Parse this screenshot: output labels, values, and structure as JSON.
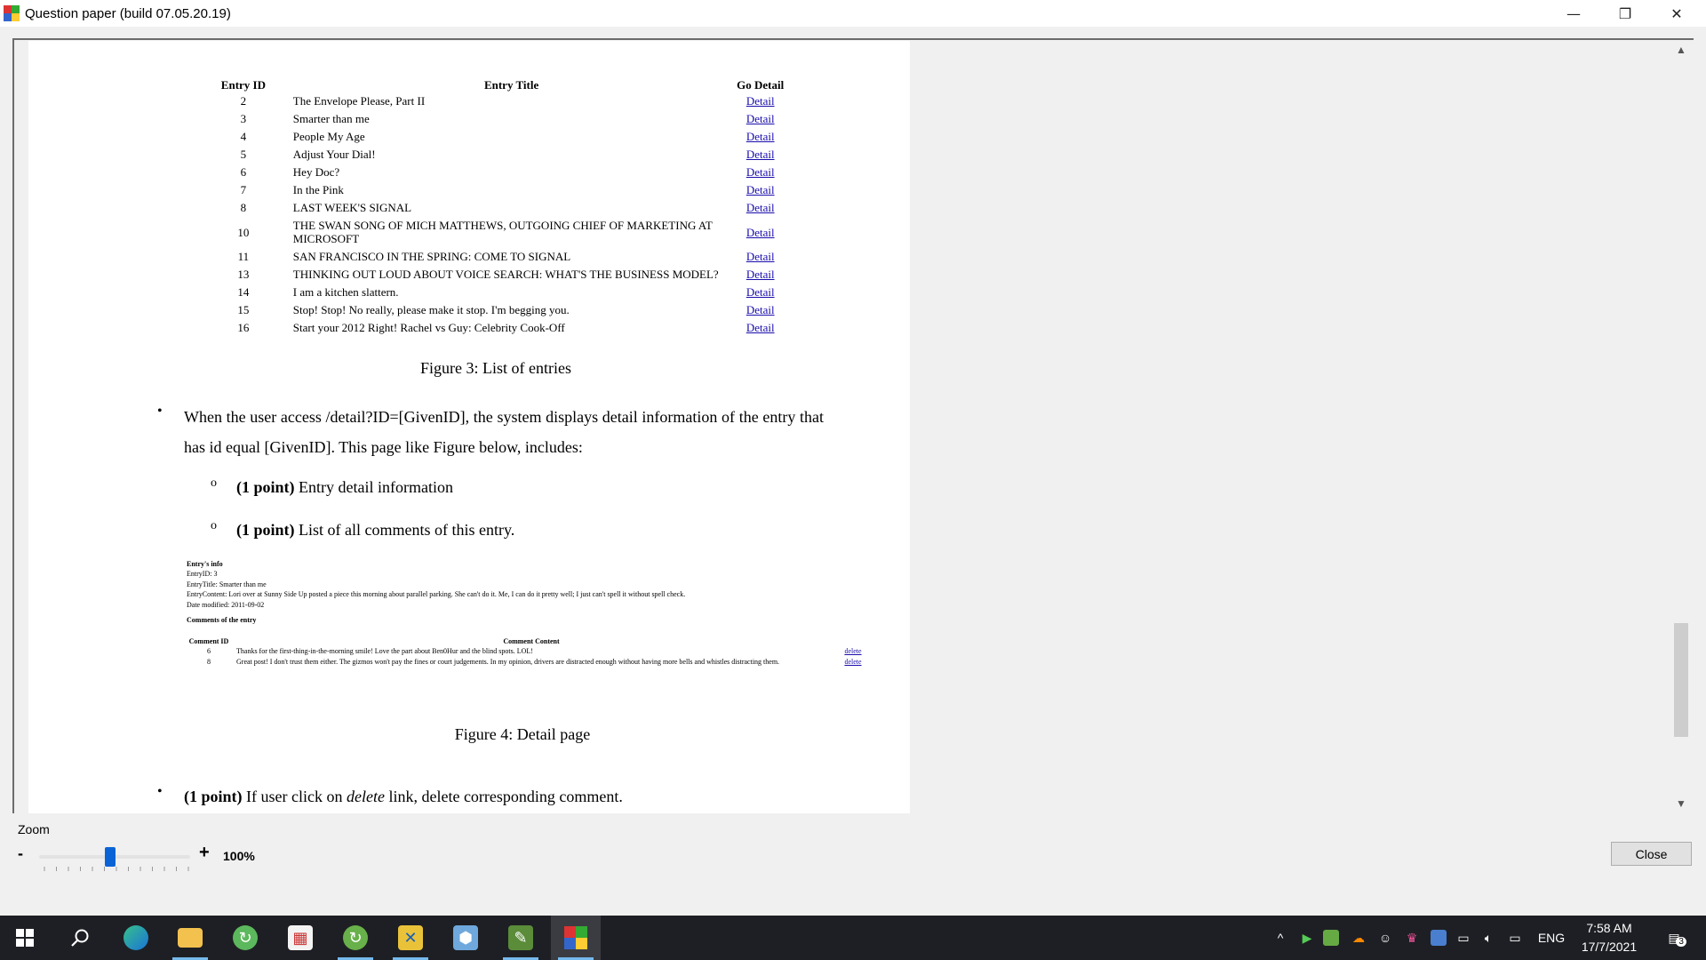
{
  "window": {
    "title": "Question paper (build 07.05.20.19)",
    "minimize": "—",
    "restore": "❐",
    "close": "✕"
  },
  "figure3": {
    "headers": {
      "id": "Entry ID",
      "title": "Entry Title",
      "go": "Go Detail"
    },
    "rows": [
      {
        "id": "2",
        "title": "The Envelope Please, Part II",
        "link": "Detail"
      },
      {
        "id": "3",
        "title": "Smarter than me",
        "link": "Detail"
      },
      {
        "id": "4",
        "title": "People My Age",
        "link": "Detail"
      },
      {
        "id": "5",
        "title": "Adjust Your Dial!",
        "link": "Detail"
      },
      {
        "id": "6",
        "title": "Hey Doc?",
        "link": "Detail"
      },
      {
        "id": "7",
        "title": "In the Pink",
        "link": "Detail"
      },
      {
        "id": "8",
        "title": "LAST WEEK'S SIGNAL",
        "link": "Detail"
      },
      {
        "id": "10",
        "title": "THE SWAN SONG OF MICH MATTHEWS, OUTGOING CHIEF OF MARKETING AT MICROSOFT",
        "link": "Detail"
      },
      {
        "id": "11",
        "title": "SAN FRANCISCO IN THE SPRING: COME TO SIGNAL",
        "link": "Detail"
      },
      {
        "id": "13",
        "title": "THINKING OUT LOUD ABOUT VOICE SEARCH: WHAT'S THE BUSINESS MODEL?",
        "link": "Detail"
      },
      {
        "id": "14",
        "title": "I am a kitchen slattern.",
        "link": "Detail"
      },
      {
        "id": "15",
        "title": "Stop! Stop! No really, please make it stop. I'm begging you.",
        "link": "Detail"
      },
      {
        "id": "16",
        "title": "Start your 2012 Right! Rachel vs Guy: Celebrity Cook-Off",
        "link": "Detail"
      }
    ],
    "caption": "Figure 3: List of entries"
  },
  "body": {
    "bullet_symbol": "•",
    "circle_symbol": "o",
    "p1": "When the user access /detail?ID=[GivenID], the system displays detail information of the entry that has id equal [GivenID]. This page like Figure below, includes:",
    "p2_bold": "(1 point)",
    "p2_text": " Entry detail information",
    "p3_bold": "(1 point)",
    "p3_text": " List of all comments of this entry.",
    "p4_bold": "(1 point)",
    "p4_text_a": " If user click on ",
    "p4_italic": "delete",
    "p4_text_b": " link, delete corresponding comment."
  },
  "figure4": {
    "info_heading": "Entry's info",
    "entry_id": "EntryID: 3",
    "entry_title": "EntryTitle: Smarter than me",
    "entry_content": "EntryContent: Lori over at Sunny Side Up posted a piece this morning about parallel parking. She can't do it. Me, I can do it pretty well; I just can't spell it without spell check.",
    "date_modified": "Date modified: 2011-09-02",
    "comments_heading": "Comments of the entry",
    "headers": {
      "id": "Comment ID",
      "content": "Comment Content"
    },
    "comments": [
      {
        "id": "6",
        "content": "Thanks for the first-thing-in-the-morning smile! Love the part about Ben0Hur and the blind spots. LOL!",
        "link": "delete"
      },
      {
        "id": "8",
        "content": "Great post! I don't trust them either. The gizmos won't pay the fines or court judgements. In my opinion, drivers are distracted enough without having more bells and whistles distracting them.",
        "link": "delete"
      }
    ],
    "caption": "Figure 4: Detail page"
  },
  "controls": {
    "zoom_label": "Zoom",
    "zoom_minus": "-",
    "zoom_plus": "+",
    "zoom_value": "100%",
    "zoom_level_fraction": 0.47,
    "close_button": "Close"
  },
  "taskbar": {
    "icons": [
      "windows-start-icon",
      "search-icon",
      "edge-icon",
      "file-explorer-icon",
      "chrome-like-icon",
      "office-icon",
      "app-icon",
      "app-icon-2",
      "box-icon",
      "editor-icon",
      "question-paper-icon"
    ],
    "language": "ENG",
    "time": "7:58 AM",
    "date": "17/7/2021",
    "notification_count": "3"
  }
}
